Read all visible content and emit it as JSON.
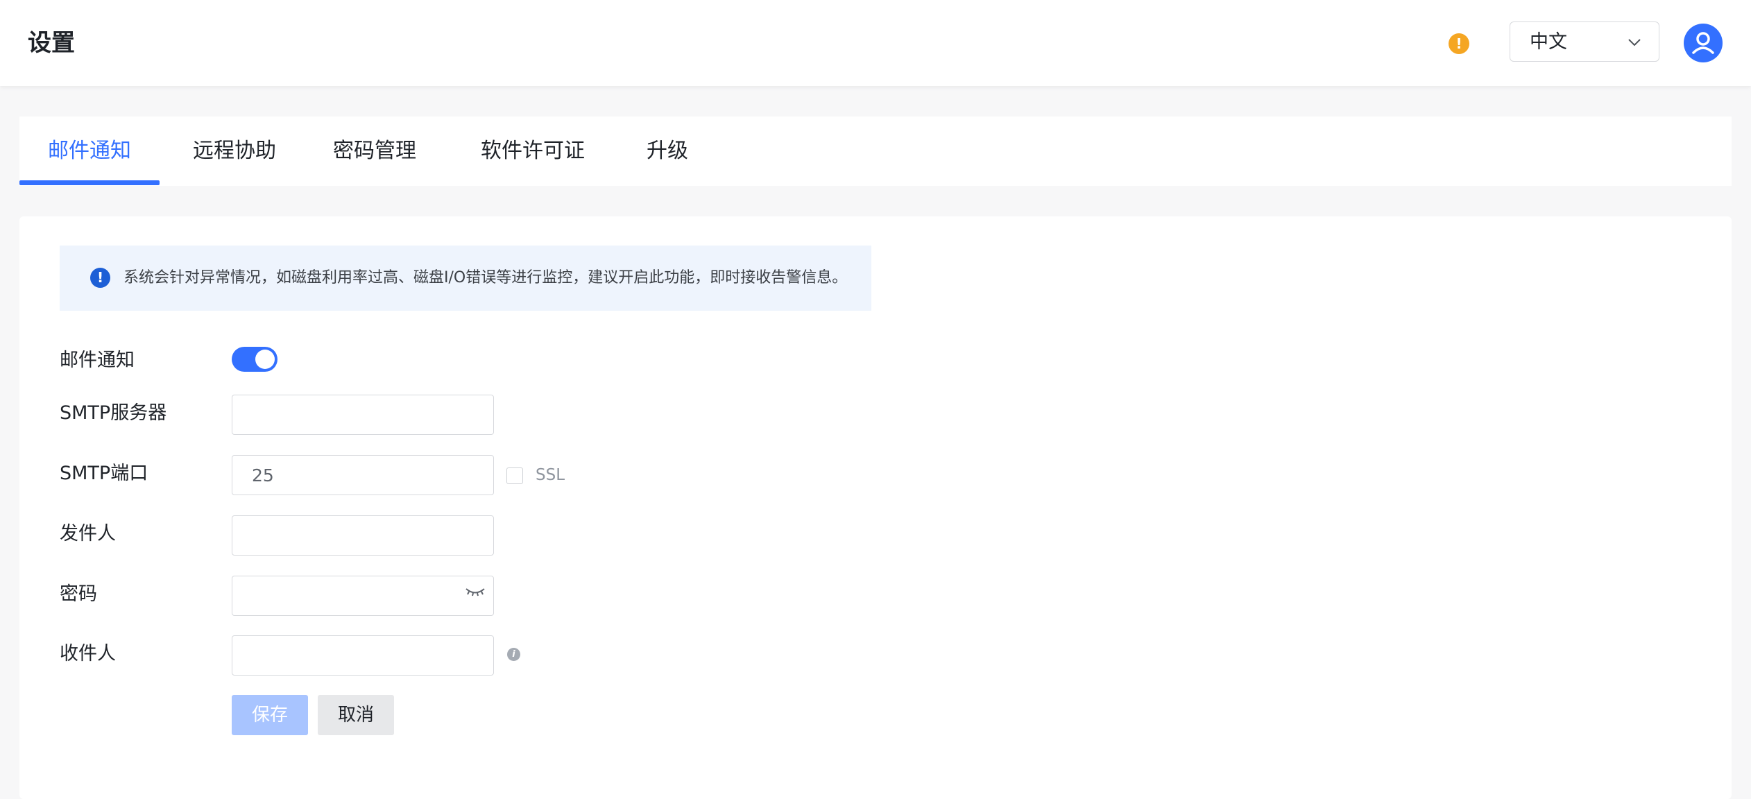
{
  "header": {
    "title": "设置",
    "language": {
      "selected": "中文"
    },
    "icons": {
      "warning": "warning-icon",
      "avatar": "user-avatar-icon"
    }
  },
  "tabs": [
    {
      "label": "邮件通知",
      "active": true
    },
    {
      "label": "远程协助",
      "active": false
    },
    {
      "label": "密码管理",
      "active": false
    },
    {
      "label": "软件许可证",
      "active": false
    },
    {
      "label": "升级",
      "active": false
    }
  ],
  "notice": {
    "text": "系统会针对异常情况，如磁盘利用率过高、磁盘I/O错误等进行监控，建议开启此功能，即时接收告警信息。"
  },
  "form": {
    "email_notify": {
      "label": "邮件通知",
      "enabled": true
    },
    "smtp_server": {
      "label": "SMTP服务器",
      "value": ""
    },
    "smtp_port": {
      "label": "SMTP端口",
      "value": "25",
      "ssl_label": "SSL",
      "ssl_checked": false
    },
    "sender": {
      "label": "发件人",
      "value": ""
    },
    "password": {
      "label": "密码",
      "value": ""
    },
    "recipient": {
      "label": "收件人",
      "value": ""
    }
  },
  "buttons": {
    "save": "保存",
    "cancel": "取消"
  },
  "colors": {
    "accent": "#3370ff",
    "warning": "#f5a623",
    "save_disabled": "#a8c4ff",
    "notice_bg": "#eef4fd"
  }
}
